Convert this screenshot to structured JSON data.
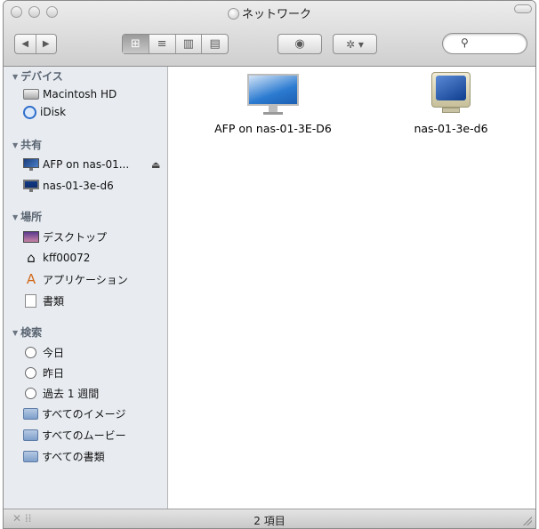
{
  "window": {
    "title": "ネットワーク"
  },
  "toolbar": {
    "back_glyph": "◀",
    "forward_glyph": "▶",
    "view_icon_glyph": "⊞",
    "view_list_glyph": "≡",
    "view_column_glyph": "▥",
    "view_coverflow_glyph": "▤",
    "quicklook_glyph": "◉",
    "action_glyph": "✲ ▾",
    "search_glyph": "⚲",
    "search_placeholder": ""
  },
  "sidebar": {
    "devices": {
      "label": "デバイス",
      "items": [
        {
          "label": "Macintosh HD",
          "icon": "hard-drive-icon"
        },
        {
          "label": "iDisk",
          "icon": "idisk-icon"
        }
      ]
    },
    "shared": {
      "label": "共有",
      "items": [
        {
          "label": "AFP on nas-01...",
          "icon": "monitor-icon",
          "eject": "⏏"
        },
        {
          "label": "nas-01-3e-d6",
          "icon": "monitor-icon"
        }
      ]
    },
    "places": {
      "label": "場所",
      "items": [
        {
          "label": "デスクトップ",
          "icon": "desktop-icon"
        },
        {
          "label": "kff00072",
          "icon": "home-icon"
        },
        {
          "label": "アプリケーション",
          "icon": "applications-icon"
        },
        {
          "label": "書類",
          "icon": "documents-icon"
        }
      ]
    },
    "search": {
      "label": "検索",
      "items": [
        {
          "label": "今日",
          "icon": "clock-icon"
        },
        {
          "label": "昨日",
          "icon": "clock-icon"
        },
        {
          "label": "過去 1 週間",
          "icon": "clock-icon"
        },
        {
          "label": "すべてのイメージ",
          "icon": "smart-folder-icon"
        },
        {
          "label": "すべてのムービー",
          "icon": "smart-folder-icon"
        },
        {
          "label": "すべての書類",
          "icon": "smart-folder-icon"
        }
      ]
    }
  },
  "content": {
    "items": [
      {
        "label": "AFP on nas-01-3E-D6",
        "icon": "lcd-monitor-icon"
      },
      {
        "label": "nas-01-3e-d6",
        "icon": "crt-monitor-icon"
      }
    ]
  },
  "status": {
    "text": "2 項目"
  },
  "colors": {
    "sidebar_bg": "#e8ecf1",
    "section_header": "#5a6572"
  }
}
